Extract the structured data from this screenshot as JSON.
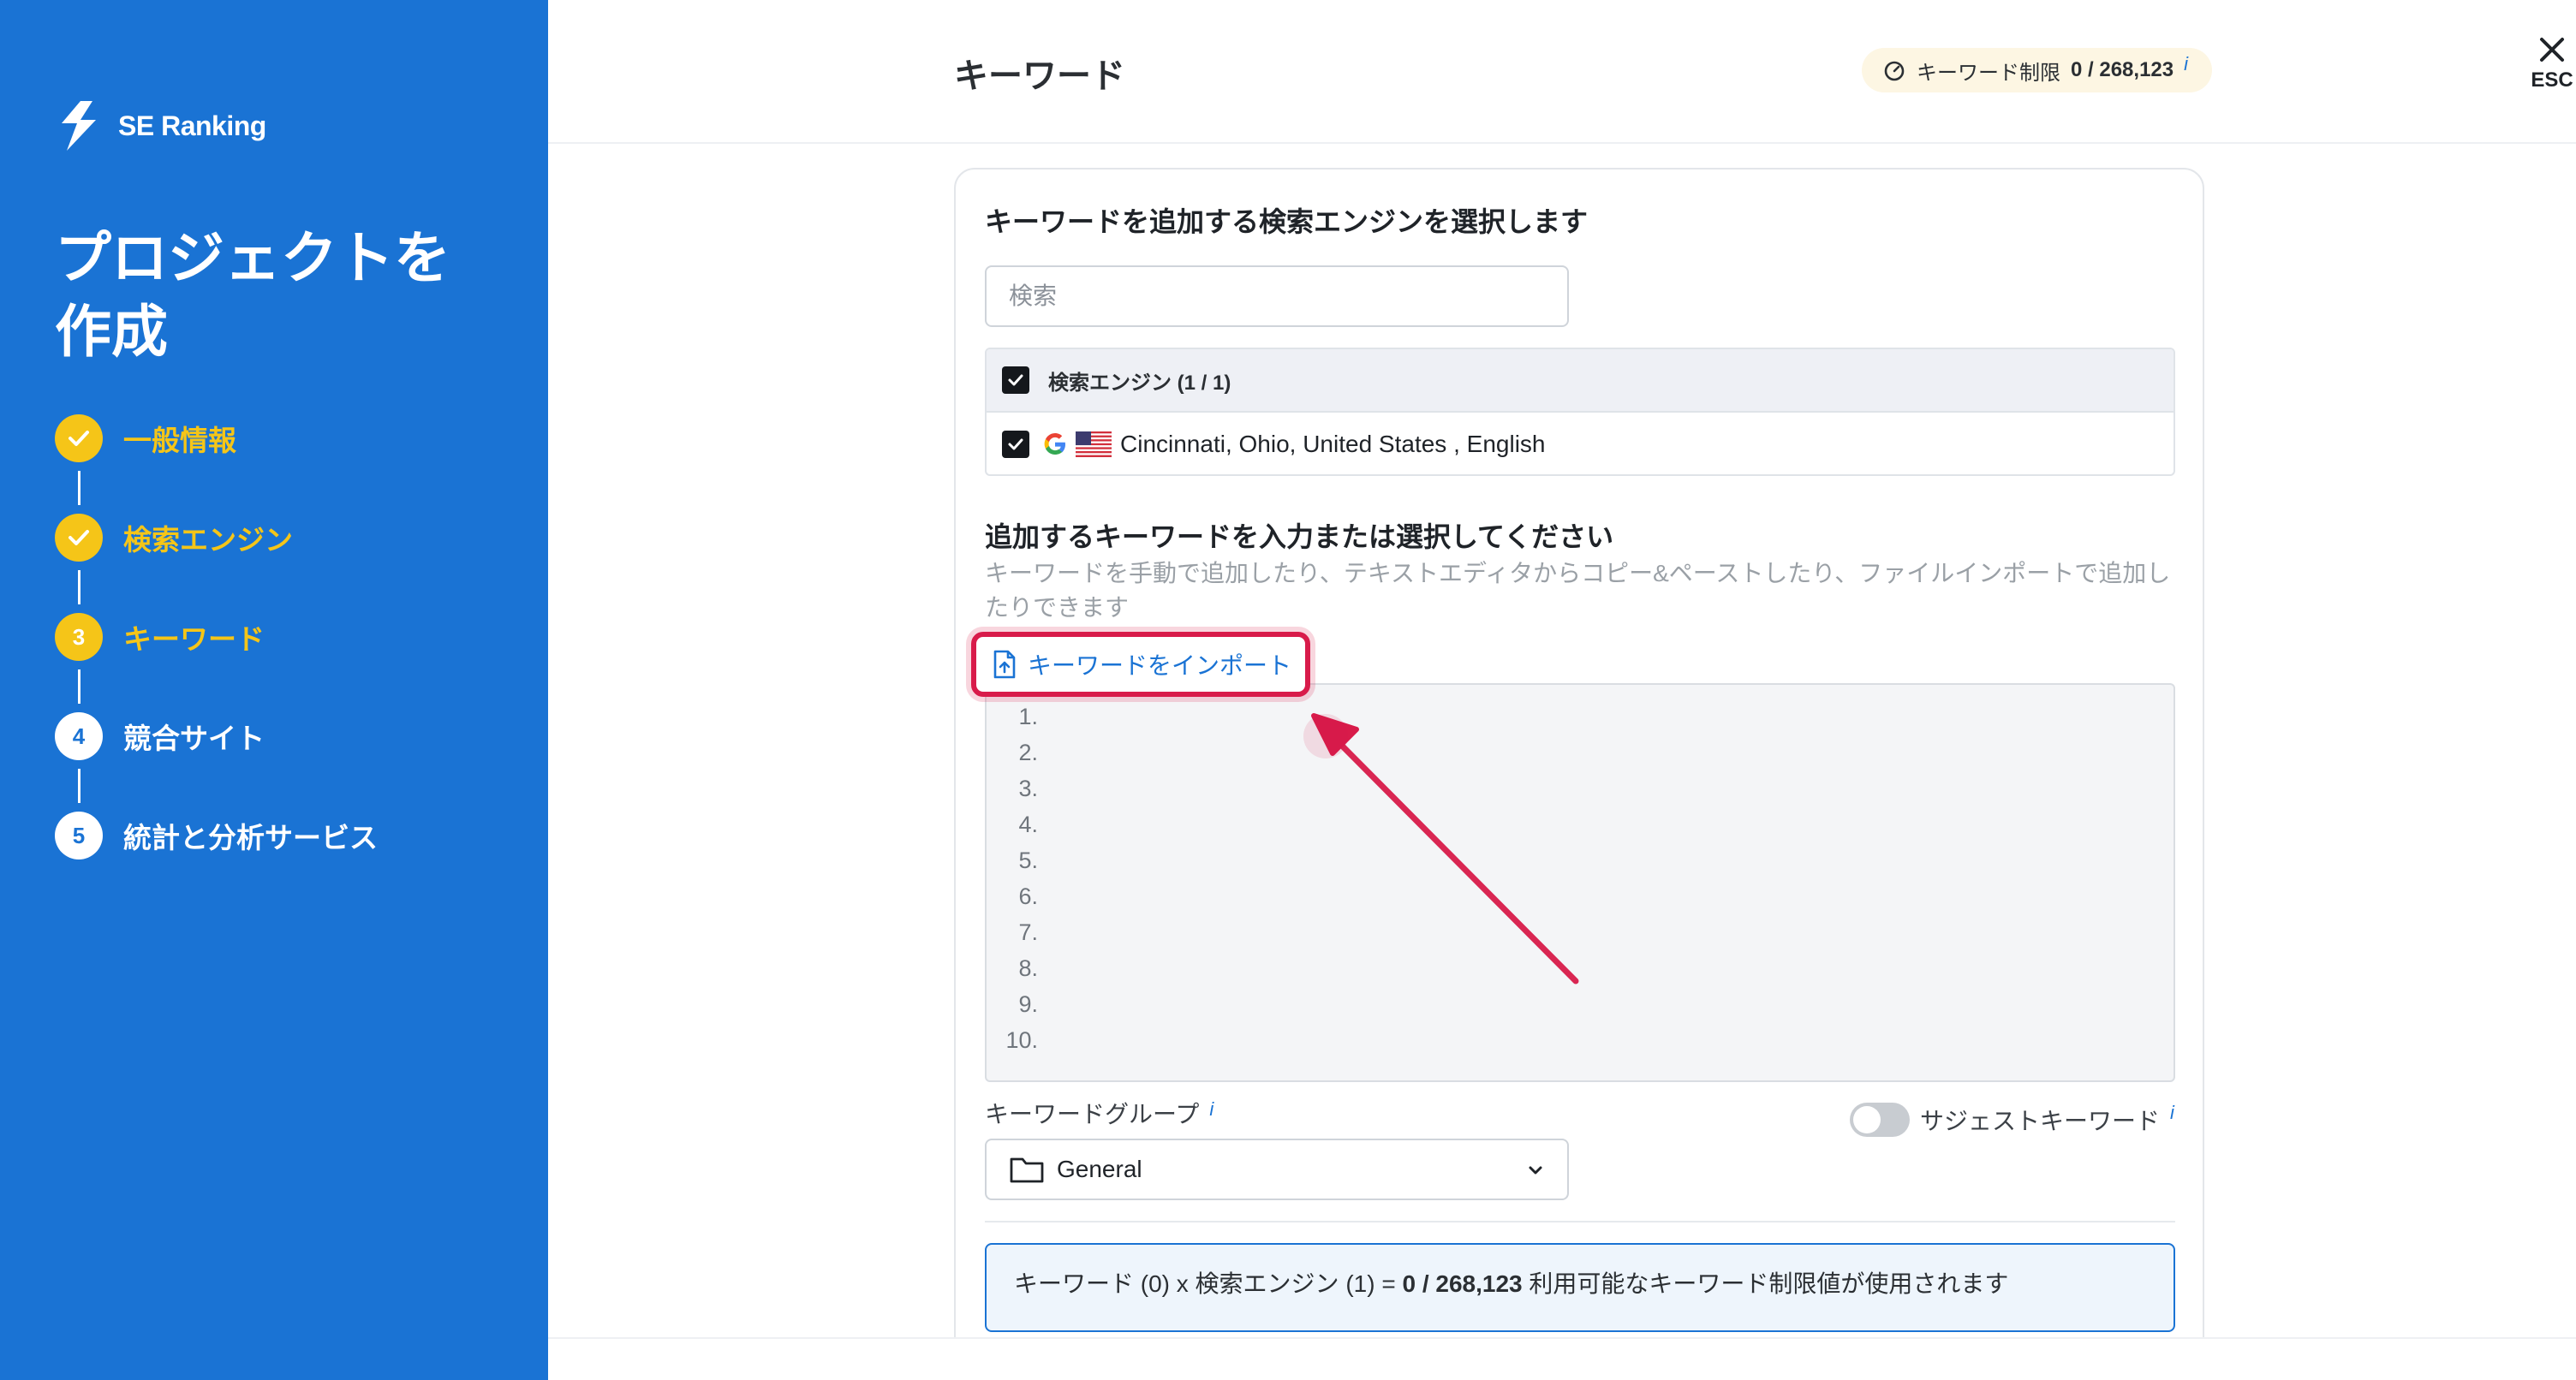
{
  "app": {
    "brand": "SE Ranking",
    "accent": "#1a73d4",
    "highlight": "#f5c518"
  },
  "sidebar": {
    "title_line1": "プロジェクトを",
    "title_line2": "作成",
    "steps": [
      {
        "marker": "",
        "label": "一般情報",
        "state": "done"
      },
      {
        "marker": "",
        "label": "検索エンジン",
        "state": "done"
      },
      {
        "marker": "3",
        "label": "キーワード",
        "state": "current"
      },
      {
        "marker": "4",
        "label": "競合サイト",
        "state": "todo"
      },
      {
        "marker": "5",
        "label": "統計と分析サービス",
        "state": "todo"
      }
    ]
  },
  "header": {
    "title": "キーワード",
    "limit_label": "キーワード制限",
    "limit_value": "0 / 268,123",
    "limit_info": "i",
    "close_label": "ESC"
  },
  "engines": {
    "title": "キーワードを追加する検索エンジンを選択します",
    "search_placeholder": "検索",
    "table_header": "検索エンジン (1 / 1)",
    "rows": [
      {
        "label": "Cincinnati, Ohio, United States , English",
        "icons": [
          "google-icon",
          "us-flag-icon"
        ]
      }
    ]
  },
  "keywords": {
    "title": "追加するキーワードを入力または選択してください",
    "description": "キーワードを手動で追加したり、テキストエディタからコピー&ペーストしたり、ファイルインポートで追加したりできます",
    "import_label": "キーワードをインポート",
    "line_numbers": [
      "1.",
      "2.",
      "3.",
      "4.",
      "5.",
      "6.",
      "7.",
      "8.",
      "9.",
      "10."
    ]
  },
  "group": {
    "label": "キーワードグループ",
    "info": "i",
    "value": "General"
  },
  "suggest": {
    "label": "サジェストキーワード",
    "info": "i",
    "enabled": false
  },
  "summary": {
    "part1": "キーワード (0) x 検索エンジン (1) = ",
    "value": "0 / 268,123",
    "part2": " 利用可能なキーワード制限値が使用されます"
  },
  "annotation": {
    "arrow_color": "#d81b4a"
  }
}
